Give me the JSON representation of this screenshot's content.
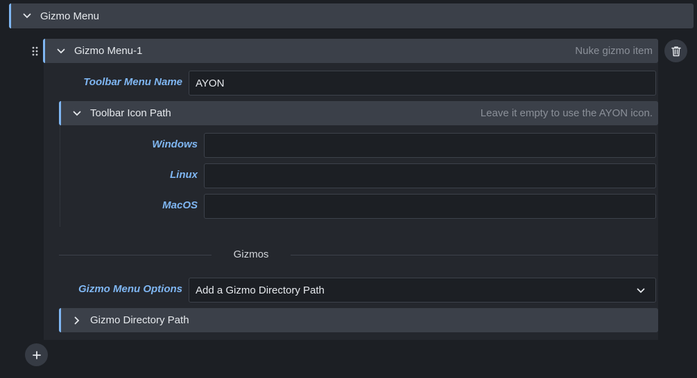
{
  "gizmo_menu": {
    "title": "Gizmo Menu",
    "item": {
      "title": "Gizmo Menu-1",
      "hint": "Nuke gizmo item",
      "toolbar_menu_name": {
        "label": "Toolbar Menu Name",
        "value": "AYON"
      },
      "toolbar_icon_path": {
        "title": "Toolbar Icon Path",
        "hint": "Leave it empty to use the AYON icon.",
        "windows": {
          "label": "Windows",
          "value": ""
        },
        "linux": {
          "label": "Linux",
          "value": ""
        },
        "macos": {
          "label": "MacOS",
          "value": ""
        }
      },
      "gizmos_section": "Gizmos",
      "gizmo_menu_options": {
        "label": "Gizmo Menu Options",
        "value": "Add a Gizmo Directory Path"
      },
      "gizmo_directory_path": {
        "title": "Gizmo Directory Path"
      }
    }
  },
  "icons": {
    "drag": "drag-handle-icon",
    "delete": "trash-icon",
    "add": "plus-icon",
    "expand": "chevron-down-icon",
    "collapse": "chevron-right-icon"
  },
  "colors": {
    "accent": "#7fb6f2",
    "header_bg": "#3b4049",
    "panel_bg": "#24272d",
    "page_bg": "#1c1f24"
  }
}
